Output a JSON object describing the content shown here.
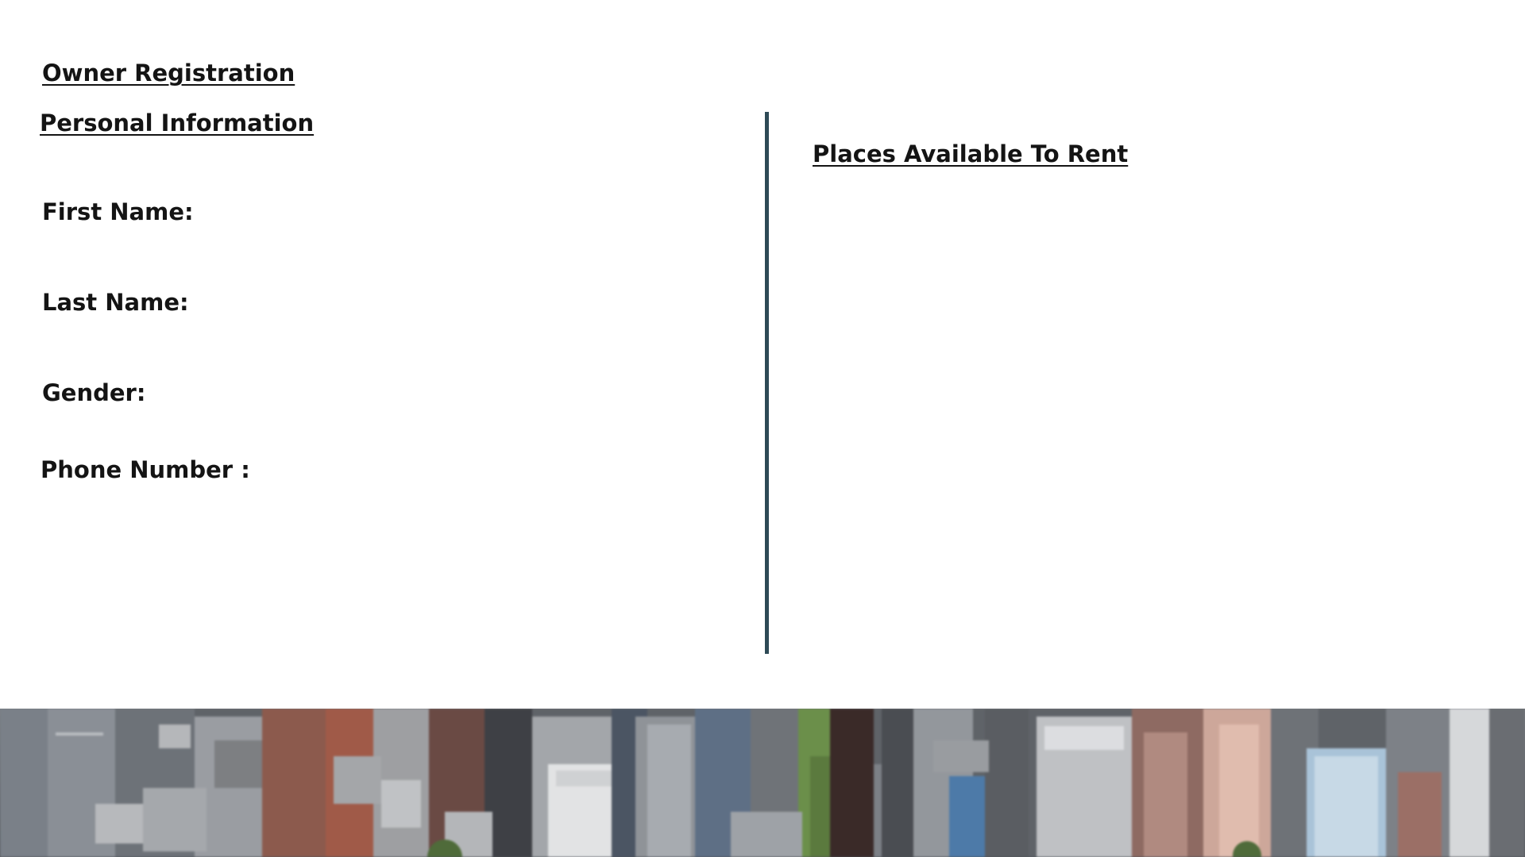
{
  "header": {
    "title": "Owner Registration"
  },
  "personal": {
    "title": "Personal Information",
    "fields": {
      "first_name": "First Name:",
      "last_name": "Last Name:",
      "gender": "Gender:",
      "phone": "Phone Number :"
    }
  },
  "places": {
    "title": "Places Available To Rent"
  },
  "colors": {
    "divider": "#2e4a56",
    "text": "#141414"
  }
}
